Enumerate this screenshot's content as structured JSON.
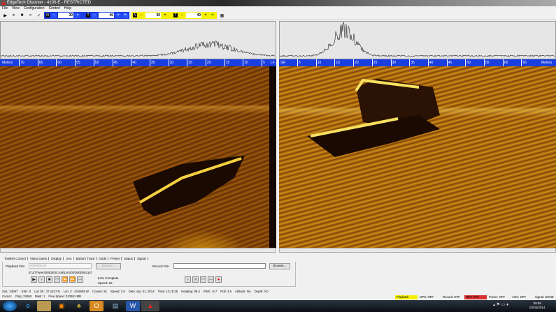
{
  "window": {
    "title": "EdgeTech Discover - 4100-E - RESTRICTED"
  },
  "menu": [
    "File",
    "View",
    "Configuration",
    "Control",
    "Help"
  ],
  "toolbar": {
    "play": "▶",
    "pause": "⏸",
    "stop": "■",
    "ff": "»",
    "check": "✓",
    "port": {
      "n_value": "30",
      "t_value": "40"
    },
    "stbd": {
      "n_value": "30",
      "t_value": "40"
    },
    "n_label": "N",
    "t_label": "T",
    "minus": "−",
    "plus": "+"
  },
  "scale_left": {
    "label": "Meters",
    "ticks": [
      "70",
      "65",
      "60",
      "55",
      "50",
      "45",
      "40",
      "35",
      "30",
      "25",
      "20",
      "15",
      "10",
      "5"
    ],
    "end": "LF"
  },
  "scale_right": {
    "start": "SR",
    "ticks": [
      "5",
      "10",
      "15",
      "20",
      "25",
      "30",
      "35",
      "40",
      "45",
      "50",
      "55",
      "60",
      "65"
    ],
    "label": "Meters"
  },
  "tabs": [
    "Towfish Control",
    "Video Gains",
    "Display",
    "Disk",
    "Bottom Track",
    "Grids",
    "Printer",
    "Status",
    "Signal"
  ],
  "active_tab": "Disk",
  "disk": {
    "playback_label": "Playback File:",
    "playback_value": "0000003.jsf",
    "browse": "Browse...",
    "path": "E:\\377wreck\\SIDESCAN\\140402\\0000003.jsf",
    "complete": "64% Complete",
    "speed": "Speed: 20",
    "record_label": "Record File:",
    "record_value": "",
    "record_browse": "Browse..."
  },
  "status_line1": [
    "SSL: 24097",
    "SSH: 0",
    "Lat:  50 : 27.1817 N",
    "Lon:  2 : 43.6509 W",
    "Course: 91",
    "Speed: 2.0",
    "Date: Apr. 01, 2014",
    "Time: 12:15:25",
    "Heading: 89.4",
    "Pitch: -6.7",
    "Roll: 3.5",
    "Altitude: NA",
    "Depth: 0.0"
  ],
  "status_line2": [
    "Cursor:",
    "Ping: 23468",
    "Mark: 1",
    "Free Space: 312551 MB"
  ],
  "indicators": [
    {
      "text": "Playback",
      "color": "#f5f000"
    },
    {
      "text": "GPS: OFF",
      "color": ""
    },
    {
      "text": "Record: OFF",
      "color": ""
    },
    {
      "text": "NET: OFF",
      "color": "#d83030"
    },
    {
      "text": "Power: OFF",
      "color": ""
    },
    {
      "text": "AGC: OFF",
      "color": ""
    },
    {
      "text": "Signal: NONE",
      "color": ""
    }
  ],
  "clock": {
    "time": "09:59",
    "date": "02/04/2014"
  }
}
